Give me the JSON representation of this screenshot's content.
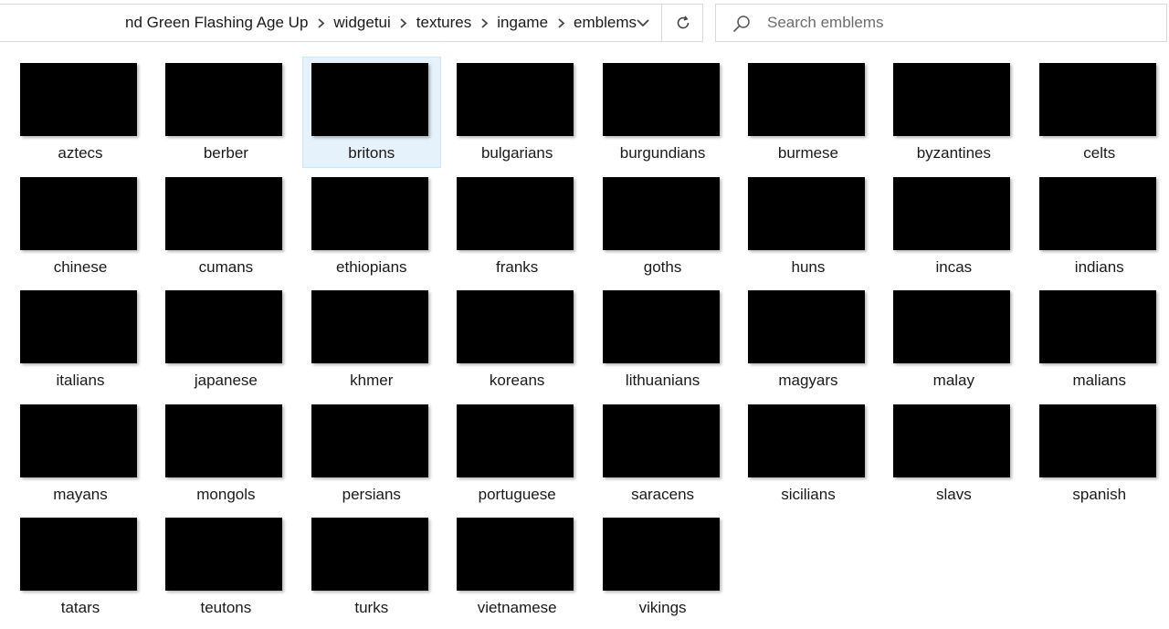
{
  "address": {
    "crumbs": [
      "nd Green Flashing Age Up",
      "widgetui",
      "textures",
      "ingame",
      "emblems"
    ],
    "icons": {
      "separator": "chevron-right-icon",
      "dropdown": "chevron-down-icon",
      "refresh": "refresh-icon"
    }
  },
  "search": {
    "placeholder": "Search emblems",
    "value": "",
    "icon": "search-icon"
  },
  "colors": {
    "selection_bg": "#e5f1fb",
    "selection_border": "#cce8ff",
    "thumbnail": "#000000"
  },
  "files": [
    {
      "name": "aztecs",
      "selected": false
    },
    {
      "name": "berber",
      "selected": false
    },
    {
      "name": "britons",
      "selected": true
    },
    {
      "name": "bulgarians",
      "selected": false
    },
    {
      "name": "burgundians",
      "selected": false
    },
    {
      "name": "burmese",
      "selected": false
    },
    {
      "name": "byzantines",
      "selected": false
    },
    {
      "name": "celts",
      "selected": false
    },
    {
      "name": "chinese",
      "selected": false
    },
    {
      "name": "cumans",
      "selected": false
    },
    {
      "name": "ethiopians",
      "selected": false
    },
    {
      "name": "franks",
      "selected": false
    },
    {
      "name": "goths",
      "selected": false
    },
    {
      "name": "huns",
      "selected": false
    },
    {
      "name": "incas",
      "selected": false
    },
    {
      "name": "indians",
      "selected": false
    },
    {
      "name": "italians",
      "selected": false
    },
    {
      "name": "japanese",
      "selected": false
    },
    {
      "name": "khmer",
      "selected": false
    },
    {
      "name": "koreans",
      "selected": false
    },
    {
      "name": "lithuanians",
      "selected": false
    },
    {
      "name": "magyars",
      "selected": false
    },
    {
      "name": "malay",
      "selected": false
    },
    {
      "name": "malians",
      "selected": false
    },
    {
      "name": "mayans",
      "selected": false
    },
    {
      "name": "mongols",
      "selected": false
    },
    {
      "name": "persians",
      "selected": false
    },
    {
      "name": "portuguese",
      "selected": false
    },
    {
      "name": "saracens",
      "selected": false
    },
    {
      "name": "sicilians",
      "selected": false
    },
    {
      "name": "slavs",
      "selected": false
    },
    {
      "name": "spanish",
      "selected": false
    },
    {
      "name": "tatars",
      "selected": false
    },
    {
      "name": "teutons",
      "selected": false
    },
    {
      "name": "turks",
      "selected": false
    },
    {
      "name": "vietnamese",
      "selected": false
    },
    {
      "name": "vikings",
      "selected": false
    }
  ]
}
